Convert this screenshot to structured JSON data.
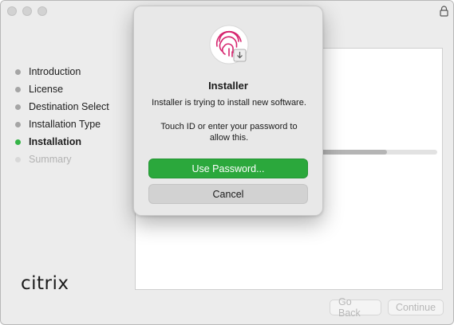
{
  "window": {
    "lock_icon": "lock-icon"
  },
  "sidebar": {
    "steps": [
      {
        "label": "Introduction",
        "state": "done"
      },
      {
        "label": "License",
        "state": "done"
      },
      {
        "label": "Destination Select",
        "state": "done"
      },
      {
        "label": "Installation Type",
        "state": "done"
      },
      {
        "label": "Installation",
        "state": "active"
      },
      {
        "label": "Summary",
        "state": "future"
      }
    ],
    "logo_text": "citrix"
  },
  "main": {
    "progress_fraction": 0.82
  },
  "footer": {
    "back_label": "Go Back",
    "continue_label": "Continue"
  },
  "dialog": {
    "icon": "touch-id-fingerprint-icon",
    "title": "Installer",
    "message": "Installer is trying to install new software.",
    "subtext": "Touch ID or enter your password to allow this.",
    "primary_button": "Use Password...",
    "cancel_button": "Cancel"
  },
  "colors": {
    "accent_green": "#2ba83c",
    "active_step_dot": "#35b447",
    "fingerprint_pink": "#d6246e"
  }
}
